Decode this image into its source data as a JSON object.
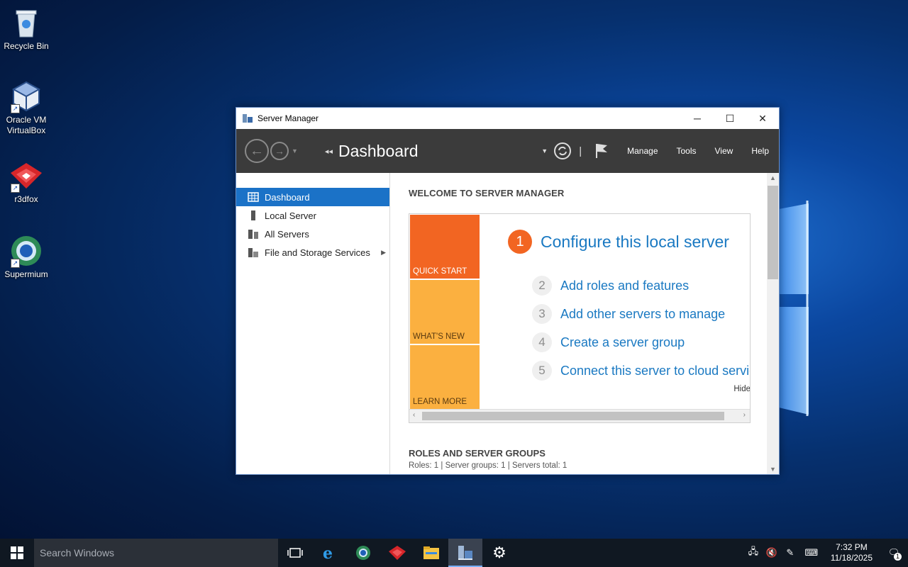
{
  "desktop": {
    "icons": [
      {
        "label": "Recycle Bin",
        "icon": "recycle-bin-icon"
      },
      {
        "label_line1": "Oracle VM",
        "label_line2": "VirtualBox",
        "icon": "virtualbox-icon"
      },
      {
        "label": "r3dfox",
        "icon": "r3dfox-icon"
      },
      {
        "label": "Supermium",
        "icon": "supermium-icon"
      }
    ]
  },
  "window": {
    "title": "Server Manager",
    "controls": {
      "minimize": "─",
      "maximize": "☐",
      "close": "✕"
    },
    "toolbar": {
      "breadcrumb": "Dashboard",
      "menu": [
        "Manage",
        "Tools",
        "View",
        "Help"
      ]
    },
    "sidebar": {
      "items": [
        {
          "label": "Dashboard",
          "icon": "dashboard-icon",
          "active": true
        },
        {
          "label": "Local Server",
          "icon": "local-server-icon"
        },
        {
          "label": "All Servers",
          "icon": "all-servers-icon"
        },
        {
          "label": "File and Storage Services",
          "icon": "storage-icon",
          "has_submenu": true
        }
      ]
    },
    "main": {
      "welcome_title": "WELCOME TO SERVER MANAGER",
      "tiles": [
        "QUICK START",
        "WHAT'S NEW",
        "LEARN MORE"
      ],
      "steps": [
        {
          "num": "1",
          "label": "Configure this local server"
        },
        {
          "num": "2",
          "label": "Add roles and features"
        },
        {
          "num": "3",
          "label": "Add other servers to manage"
        },
        {
          "num": "4",
          "label": "Create a server group"
        },
        {
          "num": "5",
          "label": "Connect this server to cloud servic"
        }
      ],
      "hide_label": "Hide",
      "roles_title": "ROLES AND SERVER GROUPS",
      "roles_summary": "Roles: 1   |   Server groups: 1   |   Servers total: 1"
    }
  },
  "taskbar": {
    "search_placeholder": "Search Windows",
    "apps": [
      "task-view-icon",
      "internet-explorer-icon",
      "supermium-icon",
      "r3dfox-icon",
      "file-explorer-icon",
      "server-manager-icon",
      "settings-icon"
    ],
    "clock": {
      "time": "7:32 PM",
      "date": "11/18/2025"
    },
    "notification_count": "1"
  },
  "colors": {
    "accent": "#1b72c7",
    "quick_start": "#f26522",
    "tile_light": "#fbb040",
    "link": "#1a79c2"
  }
}
